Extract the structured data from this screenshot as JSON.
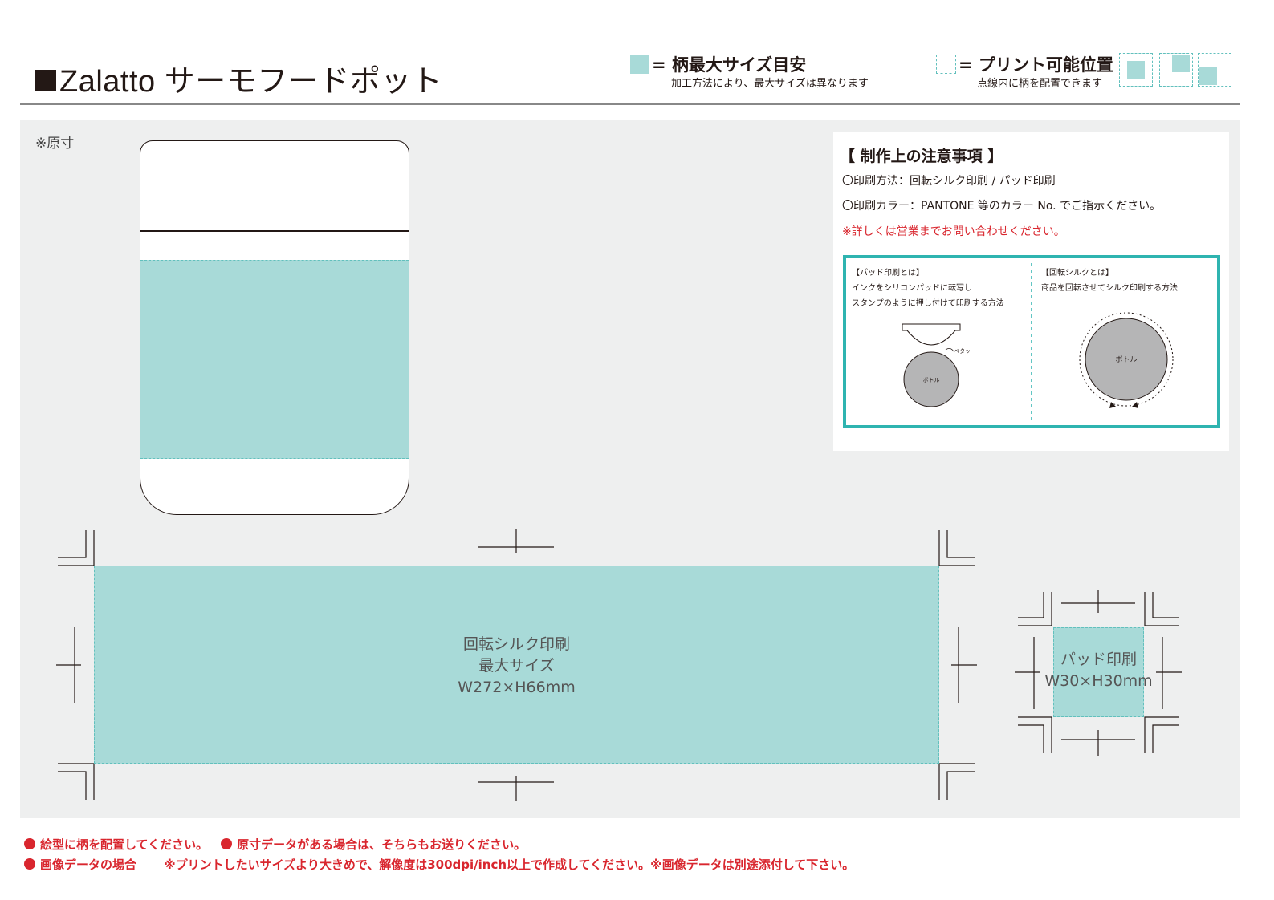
{
  "header": {
    "title": "Zalatto サーモフードポット",
    "legend_max_label": "= 柄最大サイズ目安",
    "legend_max_note": "加工方法により、最大サイズは異なります",
    "legend_print_label": "= プリント可能位置",
    "legend_print_note": "点線内に柄を配置できます"
  },
  "artwork": {
    "scale_note": "※原寸",
    "silk_label_line1": "回転シルク印刷",
    "silk_label_line2": "最大サイズ",
    "silk_label_line3": "W272×H66mm",
    "pad_label_line1": "パッド印刷",
    "pad_label_line2": "W30×H30mm"
  },
  "notice": {
    "heading": "【 制作上の注意事項 】",
    "line1": "〇印刷方法：回転シルク印刷 / パッド印刷",
    "line2": "〇印刷カラー：PANTONE 等のカラー No. でご指示ください。",
    "line3_red": "※詳しくは営業までお問い合わせください。",
    "pad_title": "【パッド印刷とは】",
    "pad_desc1": "インクをシリコンパッドに転写し",
    "pad_desc2": "スタンプのように押し付けて印刷する方法",
    "pad_tag": "ペタッ",
    "bottle_label_pad": "ボトル",
    "silk_title": "【回転シルクとは】",
    "silk_desc": "商品を回転させてシルク印刷する方法",
    "bottle_label_silk": "ボトル"
  },
  "footer": {
    "line1_a": "絵型に柄を配置してください。",
    "line1_b": "原寸データがある場合は、そちらもお送りください。",
    "line2_a": "画像データの場合",
    "line2_b": "※プリントしたいサイズより大きめで、解像度は300dpi/inch以上で作成してください。※画像データは別途添付して下さい。"
  },
  "colors": {
    "print_area_fill": "#a8dad8",
    "dashed_border": "#62c0bd",
    "inset_border": "#2fb4b0",
    "warning_red": "#d9262e",
    "work_area_bg": "#eeefef"
  }
}
